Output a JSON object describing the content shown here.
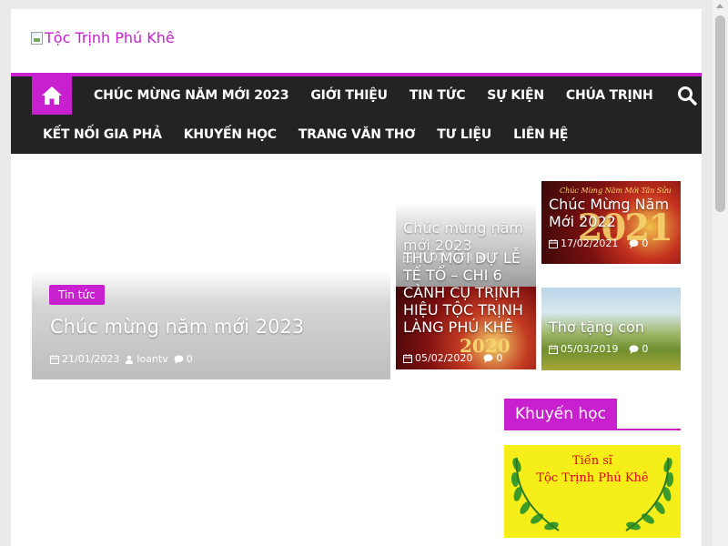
{
  "site": {
    "logo_alt": "Tộc Trịnh Phú Khê"
  },
  "nav": {
    "row1": [
      "CHÚC MỪNG NĂM MỚI 2023",
      "GIỚI THIỆU",
      "TIN TỨC",
      "SỰ KIỆN",
      "CHÚA TRỊNH"
    ],
    "row2": [
      "KẾT NỐI GIA PHẢ",
      "KHUYẾN HỌC",
      "TRANG VĂN THƠ",
      "TƯ LIỆU",
      "LIÊN HỆ"
    ]
  },
  "featured": {
    "category": "Tin tức",
    "title": "Chúc mừng năm mới 2023",
    "date": "21/01/2023",
    "author": "loantv",
    "comments": "0"
  },
  "cards": [
    {
      "title": "Chúc mừng năm mới 2023",
      "date": "21/01/2023",
      "comments": "0"
    },
    {
      "title": "Chúc Mừng Năm Mới 2022",
      "date": "17/02/2021",
      "comments": "0",
      "decor_year": "2021",
      "decor_banner": "Chúc Mừng Năm Mới Tân Sửu"
    },
    {
      "title": "THƯ MỜI DỰ LỄ TẾ TỔ – CHI 6 CÀNH CỤ TRỊNH HIỆU TỘC TRỊNH LÀNG PHÚ KHÊ",
      "date": "05/02/2020",
      "comments": "0",
      "decor_year": "2020"
    },
    {
      "title": "Thơ tặng con",
      "date": "05/03/2019",
      "comments": "0"
    }
  ],
  "widget": {
    "title": "Khuyến học",
    "image_line1": "Tiến sĩ",
    "image_line2": "Tộc Trịnh Phú Khê"
  },
  "colors": {
    "accent": "#c81fcf",
    "nav_bg": "#232323"
  }
}
